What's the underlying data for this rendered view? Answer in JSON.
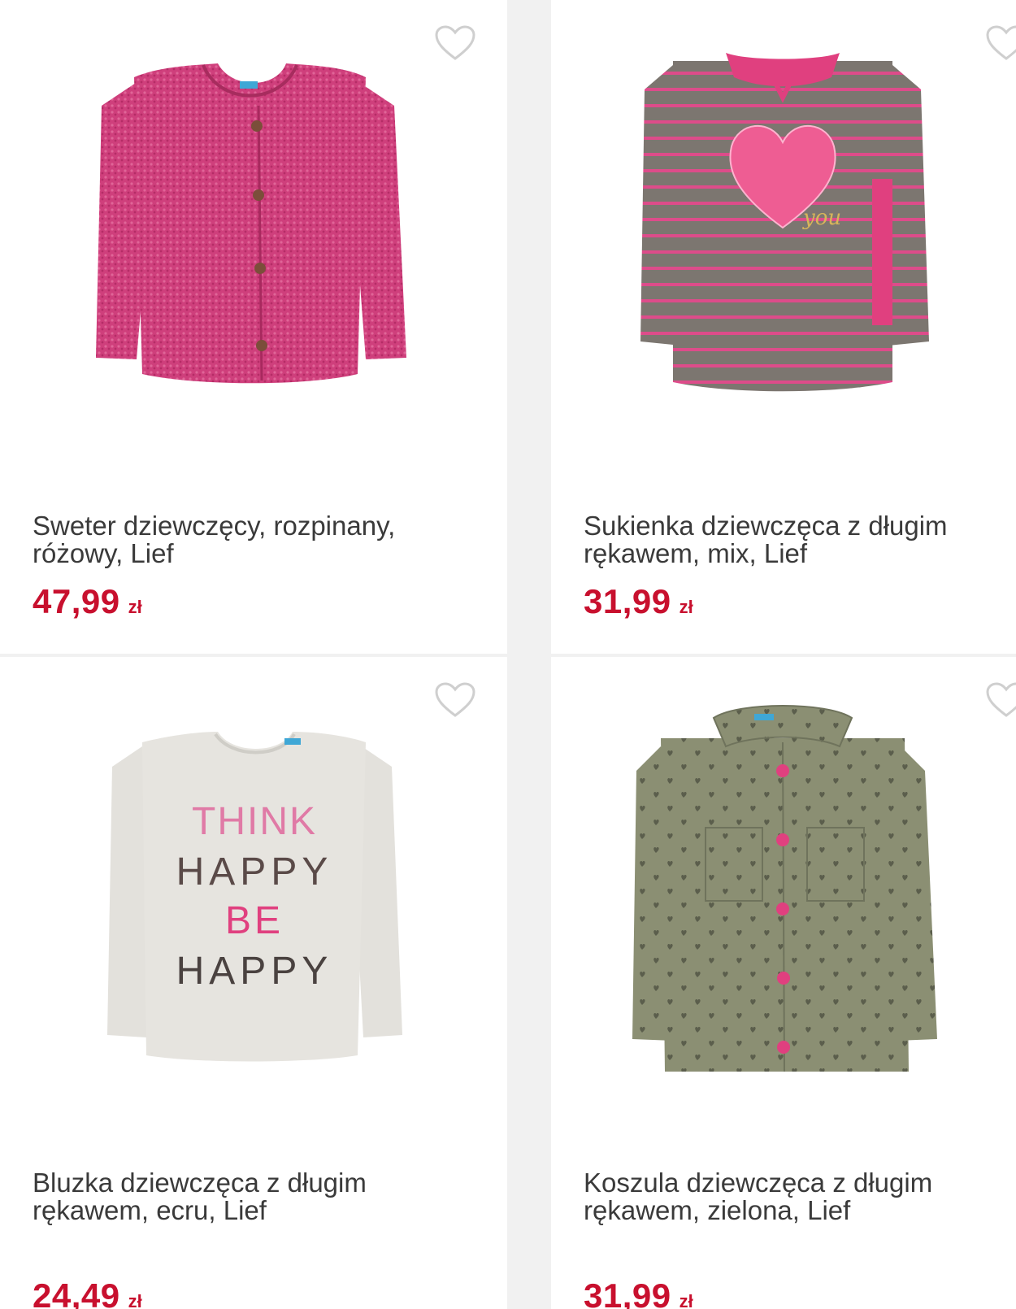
{
  "products": [
    {
      "title": "Sweter dziewczęcy, rozpinany, różowy, Lief",
      "price": "47,99",
      "currency": "zł",
      "image": "pink-cardigan",
      "color": "#d23c7a"
    },
    {
      "title": "Sukienka dziewczęca z długim rękawem, mix, Lief",
      "price": "31,99",
      "currency": "zł",
      "image": "striped-dress-heart",
      "color": "#7c7670"
    },
    {
      "title": "Bluzka dziewczęca z długim rękawem, ecru, Lief",
      "price": "24,49",
      "currency": "zł",
      "image": "think-happy-shirt",
      "color": "#e3e1dc",
      "print_text": [
        "THINK",
        "HAPPY",
        "BE",
        "HAPPY"
      ]
    },
    {
      "title": "Koszula dziewczęca z długim rękawem, zielona, Lief",
      "price": "31,99",
      "currency": "zł",
      "image": "green-heart-shirt",
      "color": "#8b8f73"
    }
  ],
  "icons": {
    "favorite": "heart-outline-icon"
  },
  "colors": {
    "price": "#c8102e",
    "background": "#f1f1f1",
    "card": "#ffffff"
  }
}
